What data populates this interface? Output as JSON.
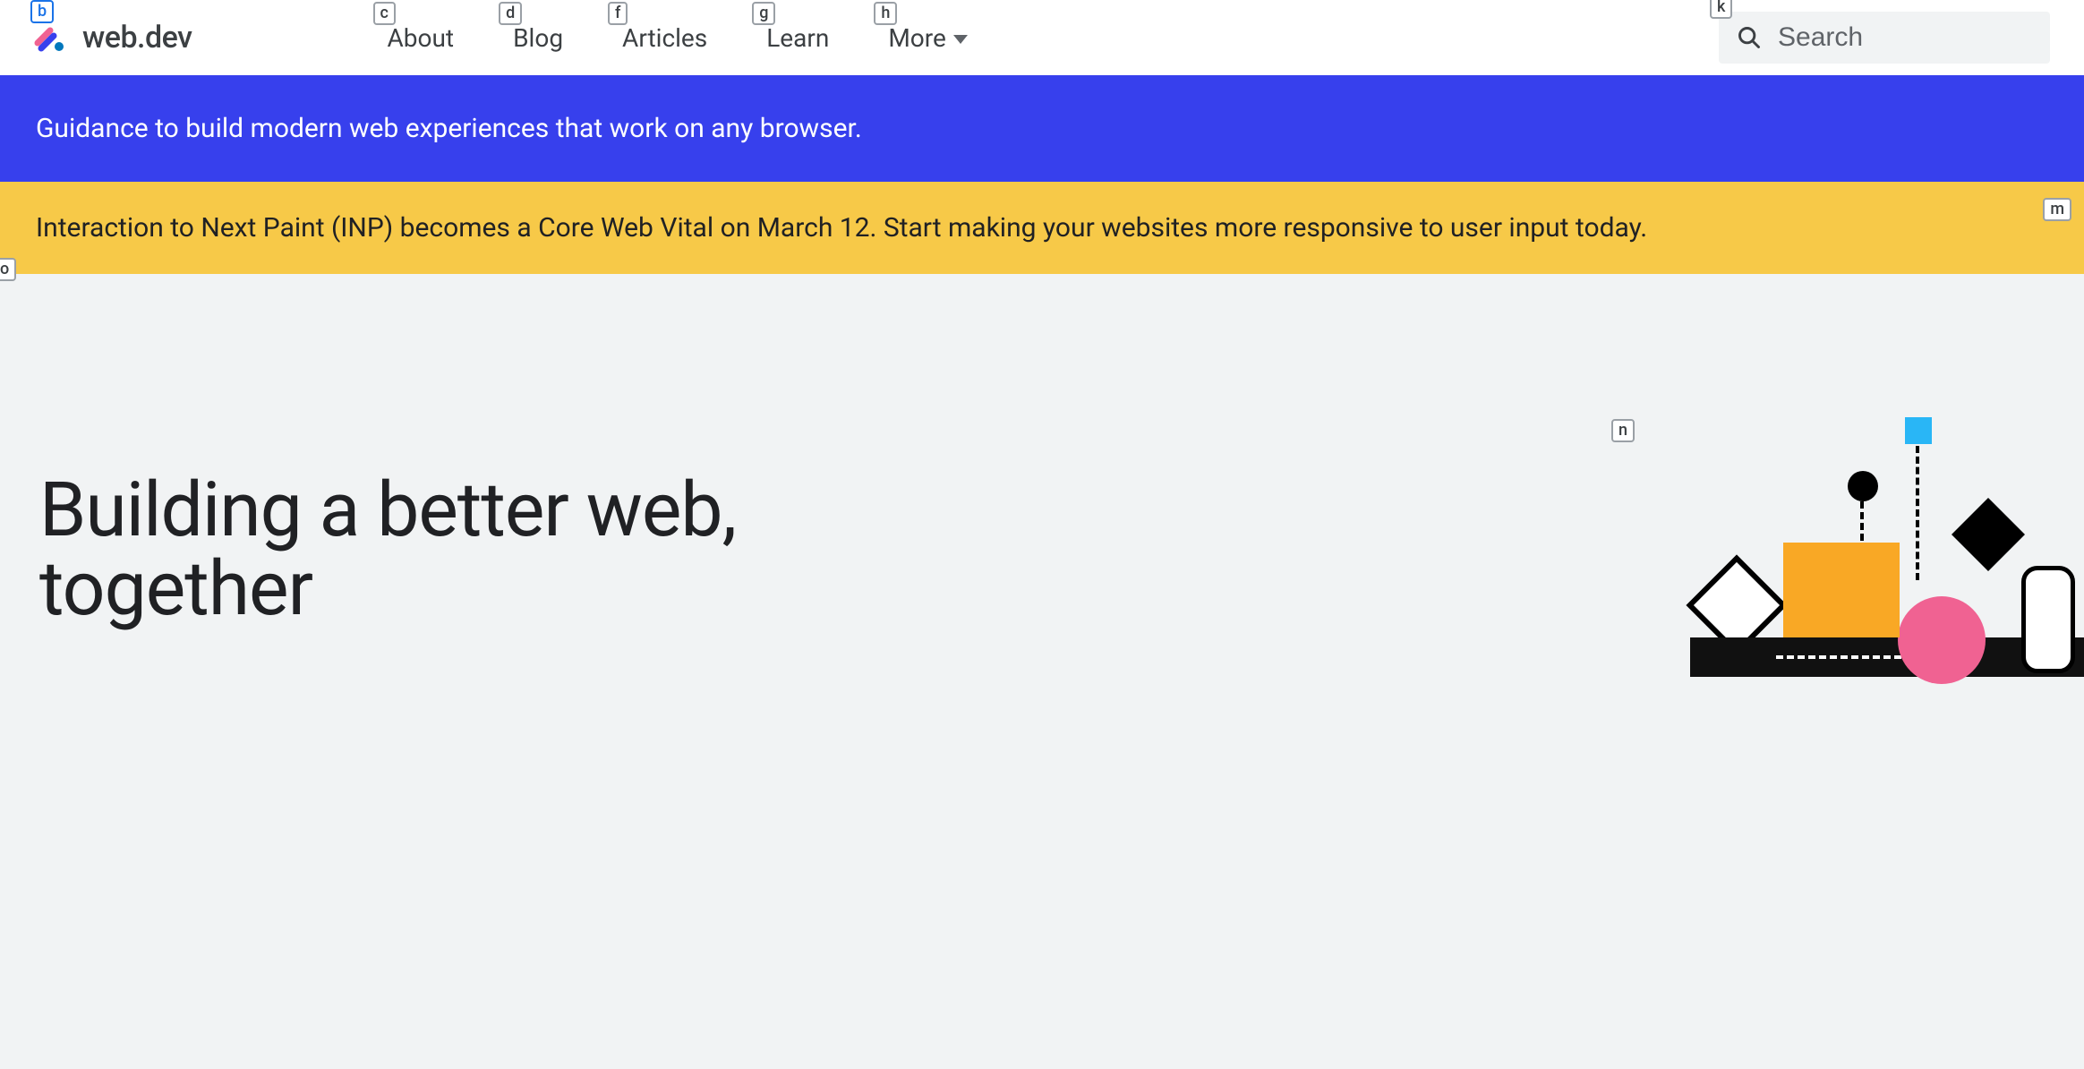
{
  "header": {
    "site_name": "web.dev",
    "nav": [
      {
        "label": "About",
        "key": "c"
      },
      {
        "label": "Blog",
        "key": "d"
      },
      {
        "label": "Articles",
        "key": "f"
      },
      {
        "label": "Learn",
        "key": "g"
      },
      {
        "label": "More",
        "key": "h",
        "dropdown": true
      }
    ],
    "logo_key": "b",
    "search": {
      "placeholder": "Search",
      "key": "k"
    }
  },
  "banners": {
    "blue": "Guidance to build modern web experiences that work on any browser.",
    "yellow": "Interaction to Next Paint (INP) becomes a Core Web Vital on March 12. Start making your websites more responsive to user input today.",
    "yellow_key": "m"
  },
  "hero": {
    "title": "Building a better web, together",
    "title_key": "o",
    "art_key": "n"
  }
}
